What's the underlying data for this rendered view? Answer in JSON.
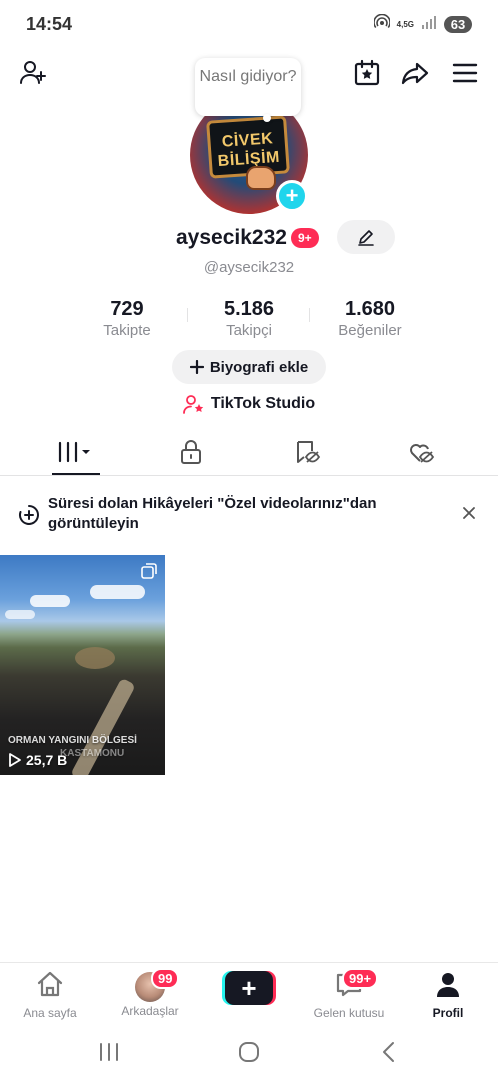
{
  "status_bar": {
    "time": "14:54",
    "network": "4,5G",
    "battery": "63"
  },
  "top_bar": {
    "add_friend_icon": "person-plus-icon",
    "calendar_icon": "calendar-star-icon",
    "share_icon": "share-arrow-icon",
    "menu_icon": "hamburger-menu-icon"
  },
  "profile": {
    "bubble_text": "Nasıl gidiyor?",
    "avatar_text_line1": "CİVEK",
    "avatar_text_line2": "BİLİŞİM",
    "username": "aysecik232",
    "username_badge": "9+",
    "handle": "@aysecik232",
    "stats": [
      {
        "value": "729",
        "label": "Takipte"
      },
      {
        "value": "5.186",
        "label": "Takipçi"
      },
      {
        "value": "1.680",
        "label": "Beğeniler"
      }
    ],
    "bio_button": "Biyografi ekle",
    "studio_link": "TikTok Studio"
  },
  "tabs": [
    {
      "name": "videos-grid",
      "icon": "grid-bars-icon",
      "active": true
    },
    {
      "name": "private",
      "icon": "lock-icon",
      "active": false
    },
    {
      "name": "saved",
      "icon": "bookmark-eye-icon",
      "active": false
    },
    {
      "name": "liked",
      "icon": "heart-eye-icon",
      "active": false
    }
  ],
  "notice": {
    "text": "Süresi dolan Hikâyeleri \"Özel videolarınız\"dan görüntüleyin"
  },
  "videos": [
    {
      "caption_line1": "ORMAN YANGINI BÖLGESİ",
      "caption_line2": "KASTAMONU",
      "views": "25,7 B"
    }
  ],
  "bottom_nav": {
    "home": "Ana sayfa",
    "friends": "Arkadaşlar",
    "friends_badge": "99",
    "inbox": "Gelen kutusu",
    "inbox_badge": "99+",
    "profile": "Profil",
    "create_symbol": "+"
  },
  "colors": {
    "accent_red": "#fe2c55",
    "accent_cyan": "#25f4ee",
    "text_primary": "#161823",
    "text_secondary": "#8a8b91"
  }
}
